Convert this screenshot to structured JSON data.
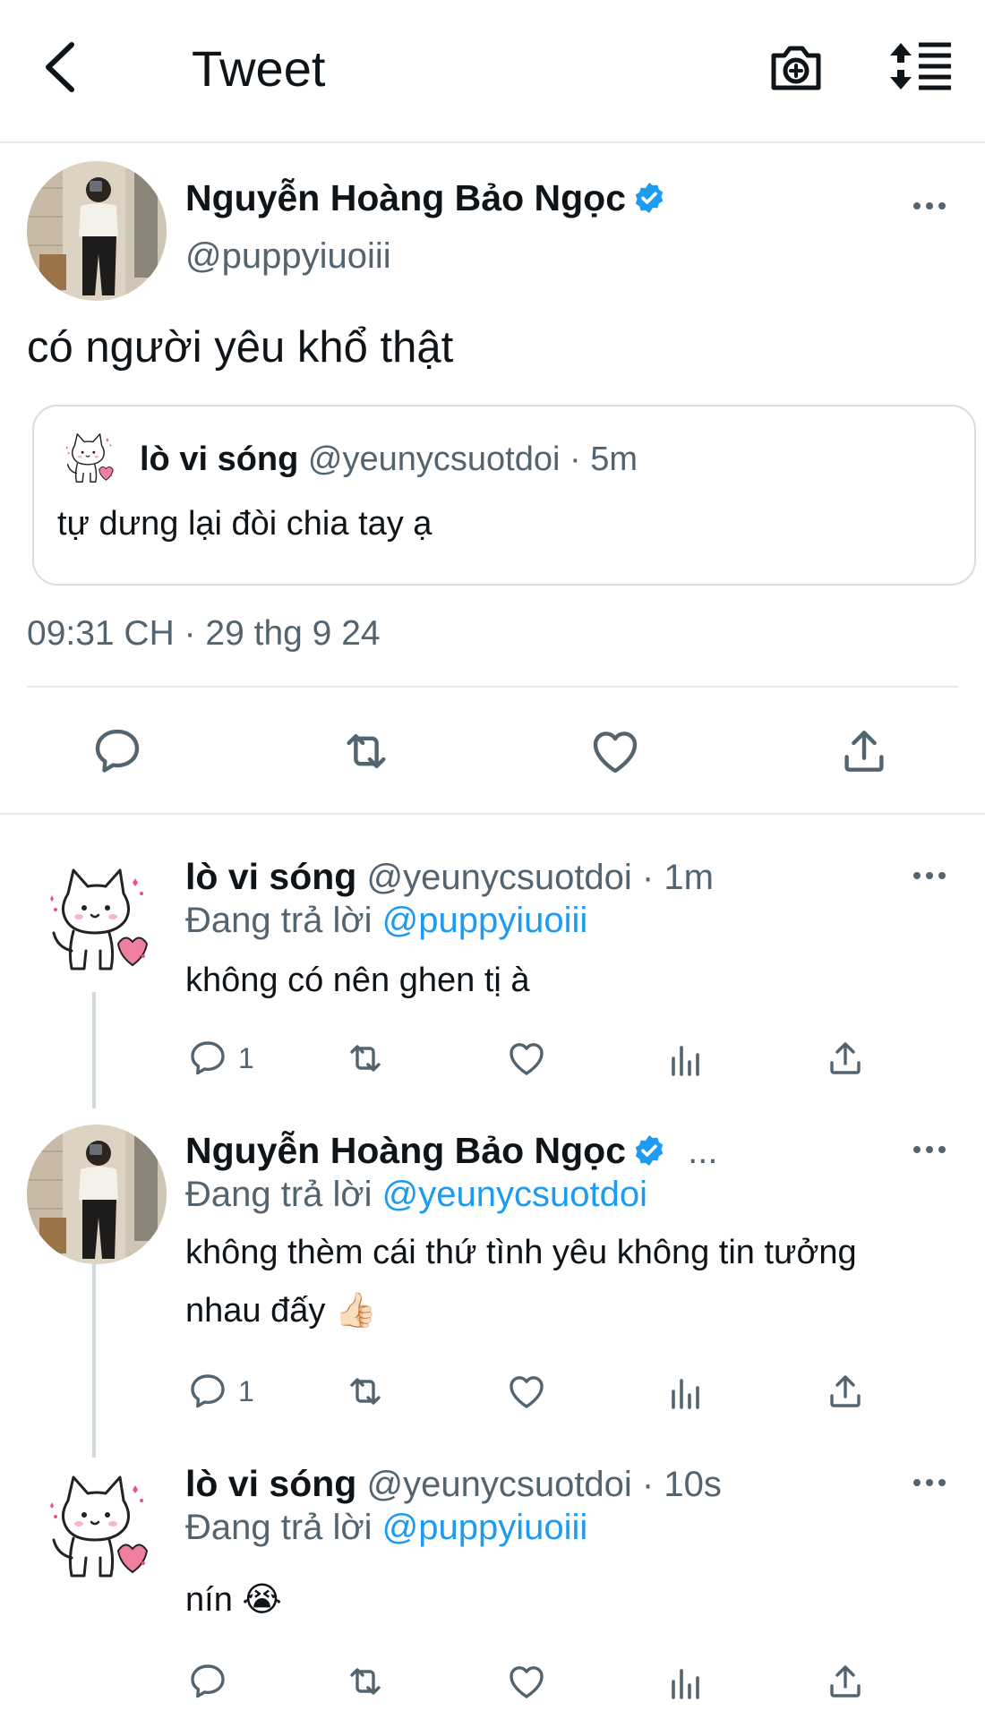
{
  "header": {
    "title": "Tweet",
    "back_icon": "chevron-left-icon",
    "camera_icon": "camera-plus-icon",
    "sort_icon": "sort-lines-icon"
  },
  "main_tweet": {
    "name": "Nguyễn Hoàng Bảo Ngọc",
    "handle": "@puppyiuoiii",
    "text": "có người yêu khổ thật",
    "quote": {
      "name": "lò vi sóng",
      "meta": "@yeunycsuotdoi · 5m",
      "text": "tự dưng lại đòi chia tay ạ"
    },
    "timestamp": "09:31 CH · 29 thg 9 24"
  },
  "replies": [
    {
      "name": "lò vi sóng",
      "meta": "@yeunycsuotdoi · 1m",
      "replying_label": "Đang trả lời",
      "replying_to": "@puppyiuoiii",
      "text": "không có nên ghen tị à",
      "reply_count": "1"
    },
    {
      "name": "Nguyễn Hoàng Bảo Ngọc",
      "meta": "...",
      "replying_label": "Đang trả lời",
      "replying_to": "@yeunycsuotdoi",
      "text_line1": "không thèm cái thứ tình yêu không tin tưởng",
      "text_line2": "nhau đấy 👍🏻",
      "reply_count": "1"
    },
    {
      "name": "lò vi sóng",
      "meta": "@yeunycsuotdoi · 10s",
      "replying_label": "Đang trả lời",
      "replying_to": "@puppyiuoiii",
      "text": "nín 😭"
    }
  ],
  "colors": {
    "accent": "#1d9bf0",
    "muted": "#536471",
    "text": "#0f1419",
    "border": "#e6e8ea"
  }
}
